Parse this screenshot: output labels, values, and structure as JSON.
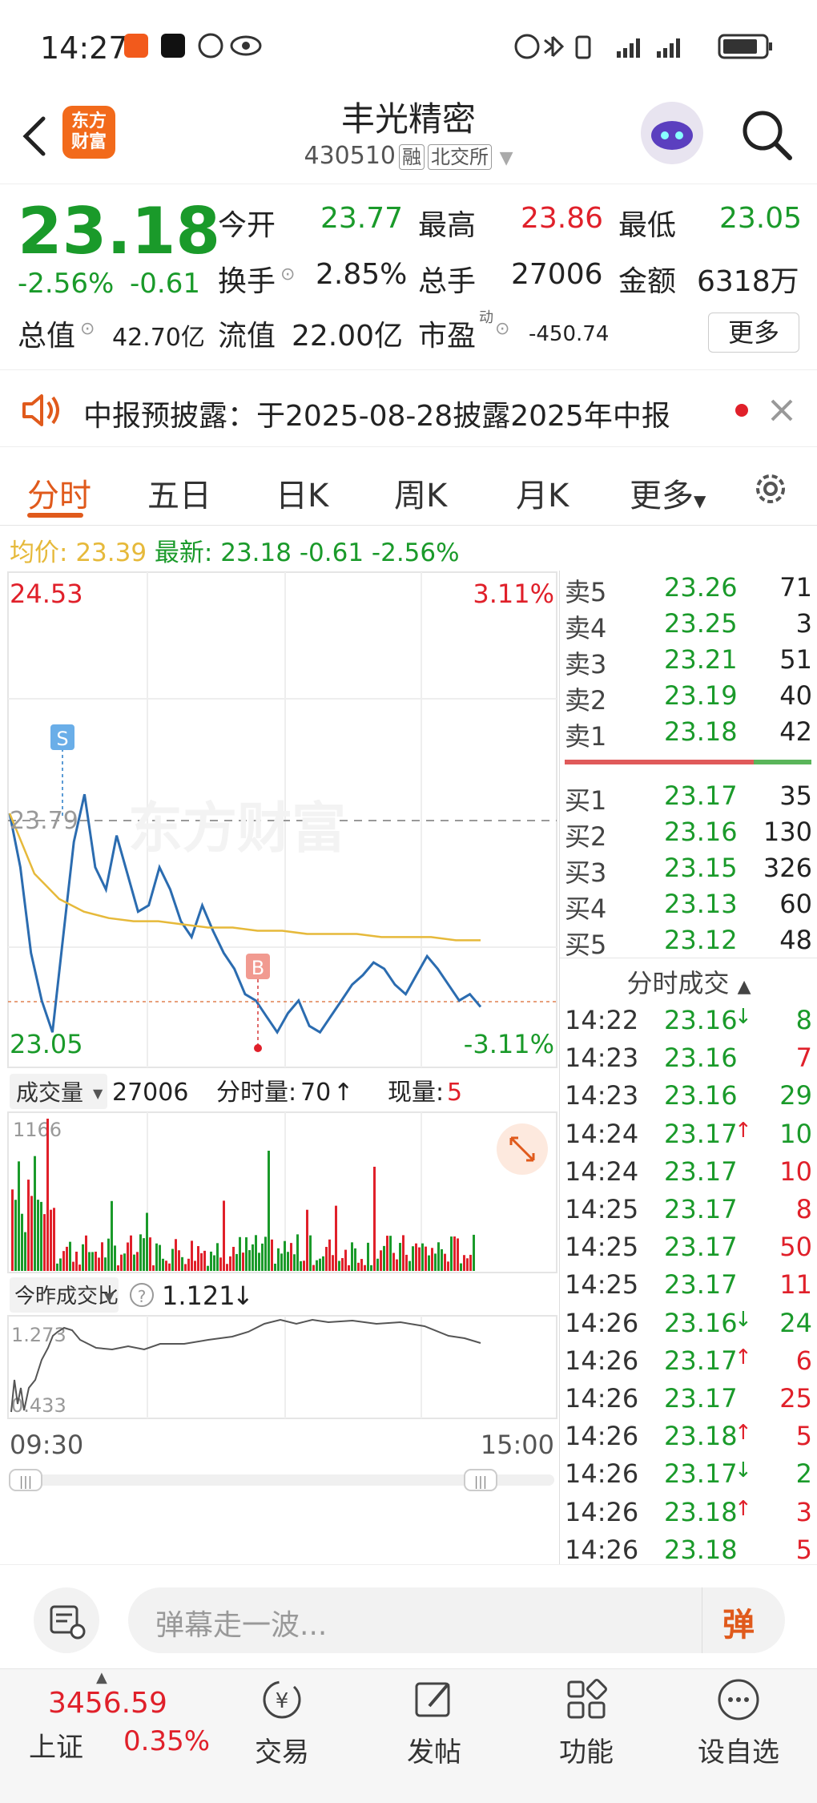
{
  "status_bar": {
    "time": "14:27"
  },
  "header": {
    "logo_text": "东方财富",
    "stock_name": "丰光精密",
    "stock_code": "430510",
    "tags": [
      "融",
      "北交所"
    ]
  },
  "quote": {
    "price": "23.18",
    "change_pct": "-2.56%",
    "change": "-0.61",
    "open_label": "今开",
    "open": "23.77",
    "high_label": "最高",
    "high": "23.86",
    "low_label": "最低",
    "low": "23.05",
    "turnover_label": "换手",
    "turnover": "2.85%",
    "volume_label": "总手",
    "volume": "27006",
    "amount_label": "金额",
    "amount": "6318万",
    "mktcap_label": "总值",
    "mktcap": "42.70亿",
    "float_label": "流值",
    "float_cap": "22.00亿",
    "pe_label": "市盈",
    "pe_sup": "动",
    "pe": "-450.74",
    "more_label": "更多"
  },
  "notice": {
    "text": "中报预披露：于2025-08-28披露2025年中报"
  },
  "tabs": [
    "分时",
    "五日",
    "日K",
    "周K",
    "月K",
    "更多"
  ],
  "info_line": {
    "avg_label": "均价:",
    "avg": "23.39",
    "latest_label": "最新:",
    "latest": "23.18",
    "change": "-0.61",
    "change_pct": "-2.56%"
  },
  "chart": {
    "y_max": "24.53",
    "y_min": "23.05",
    "pct_max": "3.11%",
    "pct_min": "-3.11%",
    "ref_price": "23.79",
    "watermark": "东方财富",
    "marker_s": "S",
    "marker_b": "B",
    "volume_label": "成交量",
    "volume_total": "27006",
    "min_volume_label": "分时量:",
    "min_volume": "70",
    "cur_label": "现量:",
    "cur_volume": "5",
    "vol_axis_max": "1166",
    "ratio_label": "今昨成交比",
    "ratio_value": "1.121",
    "ratio_max": "1.273",
    "ratio_min": "0.433",
    "time_start": "09:30",
    "time_end": "15:00"
  },
  "chart_data": {
    "type": "line",
    "title": "",
    "xlabel": "",
    "ylabel": "",
    "ylim": [
      23.05,
      24.53
    ],
    "series": [
      {
        "name": "",
        "values": [
          23.79,
          23.62,
          23.35,
          23.2,
          23.1,
          23.4,
          23.7,
          23.85,
          23.62,
          23.55,
          23.72,
          23.6,
          23.48,
          23.5,
          23.62,
          23.55,
          23.45,
          23.4,
          23.5,
          23.42,
          23.35,
          23.3,
          23.22,
          23.2,
          23.15,
          23.1,
          23.16,
          23.2,
          23.12,
          23.1,
          23.15,
          23.2,
          23.25,
          23.28,
          23.32,
          23.3,
          23.25,
          23.22,
          23.28,
          23.34,
          23.3,
          23.25,
          23.2,
          23.22,
          23.18
        ]
      },
      {
        "name": "均价",
        "values": [
          23.79,
          23.6,
          23.52,
          23.48,
          23.46,
          23.45,
          23.45,
          23.44,
          23.43,
          23.43,
          23.42,
          23.42,
          23.41,
          23.41,
          23.41,
          23.4,
          23.4,
          23.4,
          23.39,
          23.39
        ]
      }
    ]
  },
  "order_book": {
    "sell": [
      {
        "label": "卖5",
        "price": "23.26",
        "qty": "71"
      },
      {
        "label": "卖4",
        "price": "23.25",
        "qty": "3"
      },
      {
        "label": "卖3",
        "price": "23.21",
        "qty": "51"
      },
      {
        "label": "卖2",
        "price": "23.19",
        "qty": "40"
      },
      {
        "label": "卖1",
        "price": "23.18",
        "qty": "42"
      }
    ],
    "buy": [
      {
        "label": "买1",
        "price": "23.17",
        "qty": "35"
      },
      {
        "label": "买2",
        "price": "23.16",
        "qty": "130"
      },
      {
        "label": "买3",
        "price": "23.15",
        "qty": "326"
      },
      {
        "label": "买4",
        "price": "23.13",
        "qty": "60"
      },
      {
        "label": "买5",
        "price": "23.12",
        "qty": "48"
      }
    ],
    "ticks_title": "分时成交",
    "ticks": [
      {
        "time": "14:22",
        "price": "23.16",
        "arrow": "↓",
        "qty": "8",
        "pc": "green",
        "qc": "green"
      },
      {
        "time": "14:23",
        "price": "23.16",
        "arrow": "",
        "qty": "7",
        "pc": "green",
        "qc": "red"
      },
      {
        "time": "14:23",
        "price": "23.16",
        "arrow": "",
        "qty": "29",
        "pc": "green",
        "qc": "green"
      },
      {
        "time": "14:24",
        "price": "23.17",
        "arrow": "↑",
        "qty": "10",
        "pc": "green",
        "qc": "green"
      },
      {
        "time": "14:24",
        "price": "23.17",
        "arrow": "",
        "qty": "10",
        "pc": "green",
        "qc": "red"
      },
      {
        "time": "14:25",
        "price": "23.17",
        "arrow": "",
        "qty": "8",
        "pc": "green",
        "qc": "red"
      },
      {
        "time": "14:25",
        "price": "23.17",
        "arrow": "",
        "qty": "50",
        "pc": "green",
        "qc": "red"
      },
      {
        "time": "14:25",
        "price": "23.17",
        "arrow": "",
        "qty": "11",
        "pc": "green",
        "qc": "red"
      },
      {
        "time": "14:26",
        "price": "23.16",
        "arrow": "↓",
        "qty": "24",
        "pc": "green",
        "qc": "green"
      },
      {
        "time": "14:26",
        "price": "23.17",
        "arrow": "↑",
        "qty": "6",
        "pc": "green",
        "qc": "red"
      },
      {
        "time": "14:26",
        "price": "23.17",
        "arrow": "",
        "qty": "25",
        "pc": "green",
        "qc": "red"
      },
      {
        "time": "14:26",
        "price": "23.18",
        "arrow": "↑",
        "qty": "5",
        "pc": "green",
        "qc": "red"
      },
      {
        "time": "14:26",
        "price": "23.17",
        "arrow": "↓",
        "qty": "2",
        "pc": "green",
        "qc": "green"
      },
      {
        "time": "14:26",
        "price": "23.18",
        "arrow": "↑",
        "qty": "3",
        "pc": "green",
        "qc": "red"
      },
      {
        "time": "14:26",
        "price": "23.18",
        "arrow": "",
        "qty": "5",
        "pc": "green",
        "qc": "red"
      }
    ]
  },
  "comment": {
    "placeholder": "弹幕走一波...",
    "send_label": "弹"
  },
  "bottom_nav": {
    "index_value": "3456.59",
    "index_name": "上证",
    "index_change": "0.35%",
    "items": [
      "交易",
      "发帖",
      "功能",
      "设自选"
    ]
  },
  "colors": {
    "up": "#e0202a",
    "down": "#1a9a2a",
    "accent": "#e05a1c",
    "avg_line": "#e6b93a",
    "price_line": "#2b6cb0"
  }
}
